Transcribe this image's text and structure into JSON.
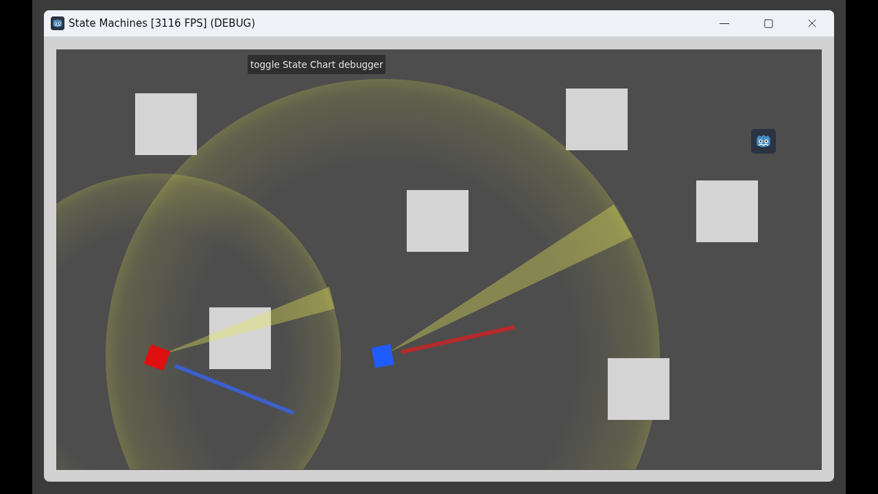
{
  "window": {
    "title": "State Machines [3116 FPS] (DEBUG)"
  },
  "overlay_button": {
    "label": "toggle State Chart debugger"
  }
}
